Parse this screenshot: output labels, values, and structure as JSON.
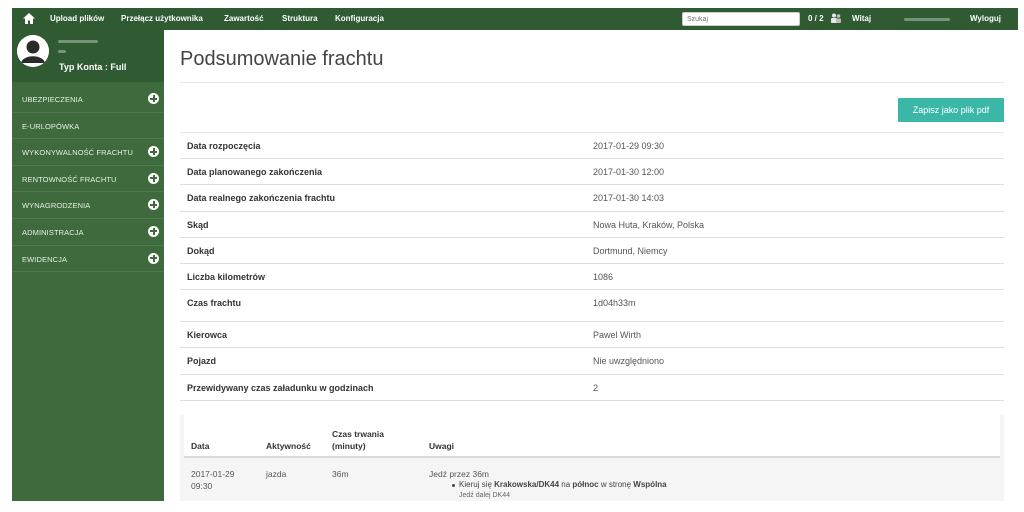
{
  "topbar": {
    "home_icon": "home-icon",
    "links": [
      "Upload plików",
      "Przełącz użytkownika",
      "Zawartość",
      "Struktura",
      "Konfiguracja"
    ],
    "search_placeholder": "Szukaj",
    "counter": "0 / 2",
    "users_icon": "users-icon",
    "greeting": "Witaj",
    "logout": "Wyloguj"
  },
  "sidebar": {
    "account_type": "Typ Konta : Full",
    "avatar_icon": "user-avatar-icon",
    "items": [
      {
        "label": "UBEZPIECZENIA",
        "expandable": true
      },
      {
        "label": "E-URLOPÓWKA",
        "expandable": false
      },
      {
        "label": "WYKONYWALNOŚĆ FRACHTU",
        "expandable": true
      },
      {
        "label": "RENTOWNOŚĆ FRACHTU",
        "expandable": true
      },
      {
        "label": "WYNAGRODZENIA",
        "expandable": true
      },
      {
        "label": "ADMINISTRACJA",
        "expandable": true
      },
      {
        "label": "EWIDENCJA",
        "expandable": true
      }
    ]
  },
  "main": {
    "title": "Podsumowanie frachtu",
    "pdf_button": "Zapisz jako plik pdf",
    "summary": [
      {
        "key": "Data rozpoczęcia",
        "value": "2017-01-29 09:30"
      },
      {
        "key": "Data planowanego zakończenia",
        "value": "2017-01-30 12:00"
      },
      {
        "key": "Data realnego zakończenia frachtu",
        "value": "2017-01-30 14:03"
      },
      {
        "key": "Skąd",
        "value": "Nowa Huta, Kraków, Polska"
      },
      {
        "key": "Dokąd",
        "value": "Dortmund, Niemcy"
      },
      {
        "key": "Liczba kilometrów",
        "value": "1086"
      },
      {
        "key": "Czas frachtu",
        "value": "1d04h33m"
      },
      {
        "key": "Kierowca",
        "value": "Pawel Wirth"
      },
      {
        "key": "Pojazd",
        "value": "Nie uwzględniono"
      },
      {
        "key": "Przewidywany czas załadunku w godzinach",
        "value": "2"
      }
    ],
    "activity": {
      "headers": {
        "date": "Data",
        "activity": "Aktywność",
        "duration_line1": "Czas trwania",
        "duration_line2": "(minuty)",
        "notes": "Uwagi"
      },
      "rows": [
        {
          "date_line1": "2017-01-29",
          "date_line2": "09:30",
          "activity": "jazda",
          "duration": "36m",
          "note": "Jedź przez 36m",
          "step_prefix": "Kieruj się ",
          "step_road": "Krakowska/DK44",
          "step_mid1": " na ",
          "step_dir": "północ",
          "step_mid2": " w stronę ",
          "step_target": "Wspólna",
          "step_continue": "Jedź dalej DK44"
        }
      ]
    }
  },
  "colors": {
    "topbar": "#2f5a32",
    "sidebar": "#3e6a3e",
    "pdf_button": "#3bb7a8"
  }
}
